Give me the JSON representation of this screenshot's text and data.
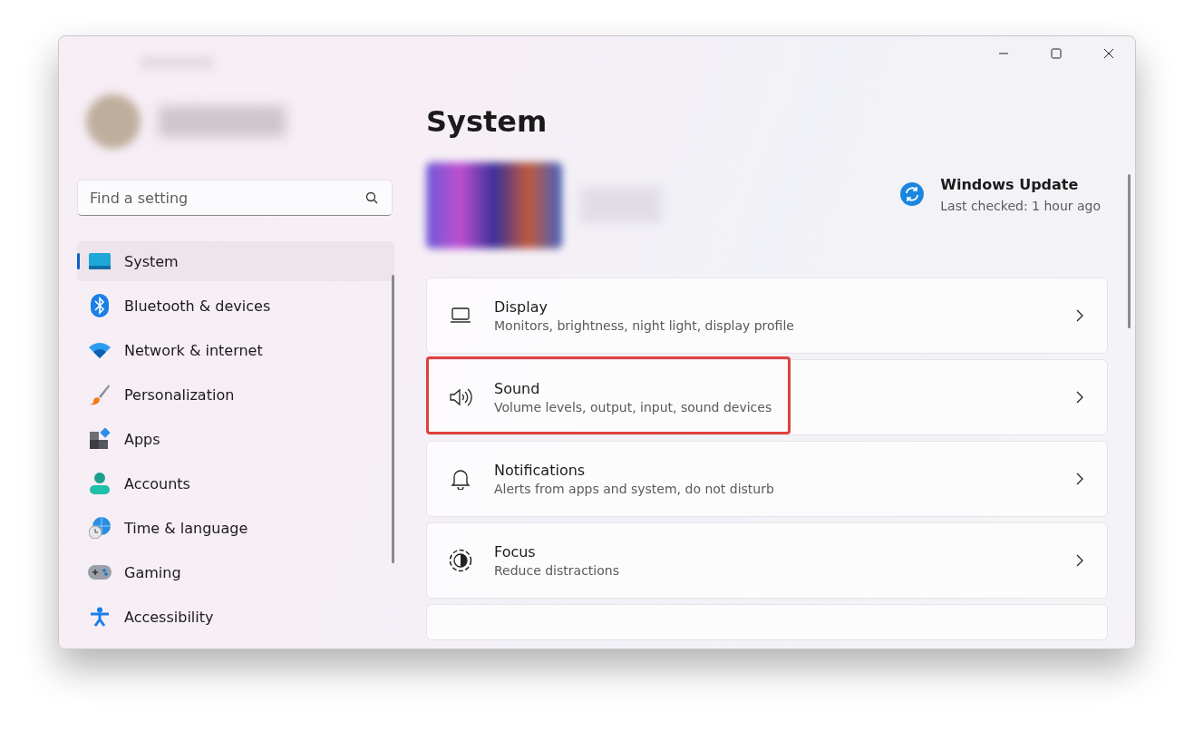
{
  "sidebar": {
    "search": {
      "placeholder": "Find a setting"
    },
    "items": [
      {
        "label": "System",
        "selected": true
      },
      {
        "label": "Bluetooth & devices",
        "selected": false
      },
      {
        "label": "Network & internet",
        "selected": false
      },
      {
        "label": "Personalization",
        "selected": false
      },
      {
        "label": "Apps",
        "selected": false
      },
      {
        "label": "Accounts",
        "selected": false
      },
      {
        "label": "Time & language",
        "selected": false
      },
      {
        "label": "Gaming",
        "selected": false
      },
      {
        "label": "Accessibility",
        "selected": false
      }
    ]
  },
  "page": {
    "title": "System",
    "update": {
      "title": "Windows Update",
      "subtitle": "Last checked: 1 hour ago"
    },
    "cards": [
      {
        "title": "Display",
        "subtitle": "Monitors, brightness, night light, display profile",
        "highlighted": false
      },
      {
        "title": "Sound",
        "subtitle": "Volume levels, output, input, sound devices",
        "highlighted": true
      },
      {
        "title": "Notifications",
        "subtitle": "Alerts from apps and system, do not disturb",
        "highlighted": false
      },
      {
        "title": "Focus",
        "subtitle": "Reduce distractions",
        "highlighted": false
      }
    ]
  }
}
